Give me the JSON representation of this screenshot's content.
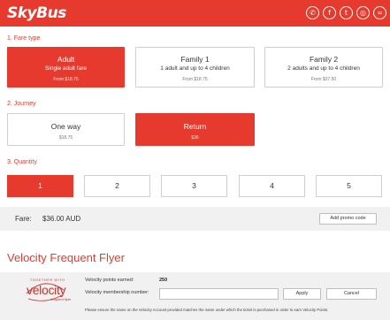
{
  "brand": {
    "name": "SkyBus",
    "accent": "#e63a2e"
  },
  "social": [
    {
      "name": "phone-icon",
      "glyph": "✆"
    },
    {
      "name": "facebook-icon",
      "glyph": "f"
    },
    {
      "name": "twitter-icon",
      "glyph": "t"
    },
    {
      "name": "instagram-icon",
      "glyph": "◎"
    },
    {
      "name": "tripadvisor-icon",
      "glyph": "∞"
    }
  ],
  "fare_type": {
    "label": "1. Fare type",
    "options": [
      {
        "title": "Adult",
        "subtitle": "Single adult fare",
        "price": "From $18.75",
        "selected": true
      },
      {
        "title": "Family 1",
        "subtitle": "1 adult and up to 4 children",
        "price": "From $18.75",
        "selected": false
      },
      {
        "title": "Family 2",
        "subtitle": "2 adults and up to 4 children",
        "price": "From $37.50",
        "selected": false
      }
    ]
  },
  "journey": {
    "label": "2. Journey",
    "options": [
      {
        "title": "One way",
        "price": "$18.75",
        "selected": false
      },
      {
        "title": "Return",
        "price": "$36",
        "selected": true
      }
    ]
  },
  "quantity": {
    "label": "3. Quantity",
    "options": [
      "1",
      "2",
      "3",
      "4",
      "5"
    ],
    "selected": "1"
  },
  "fare": {
    "label": "Fare:",
    "value": "$36.00 AUD",
    "promo_button": "Add promo code"
  },
  "velocity": {
    "title": "Velocity Frequent Flyer",
    "logo_top": "TOGETHER WITH",
    "logo_word": "velocity",
    "logo_sub": "frequent flyer",
    "points_label": "Velocity points earned:",
    "points_value": "250",
    "membership_label": "Velocity membership number:",
    "membership_value": "",
    "apply_button": "Apply",
    "cancel_button": "Cancel",
    "note": "Please ensure the name on the Velocity Account provided matches the name under which the ticket is purchased in order to earn Velocity Points."
  }
}
